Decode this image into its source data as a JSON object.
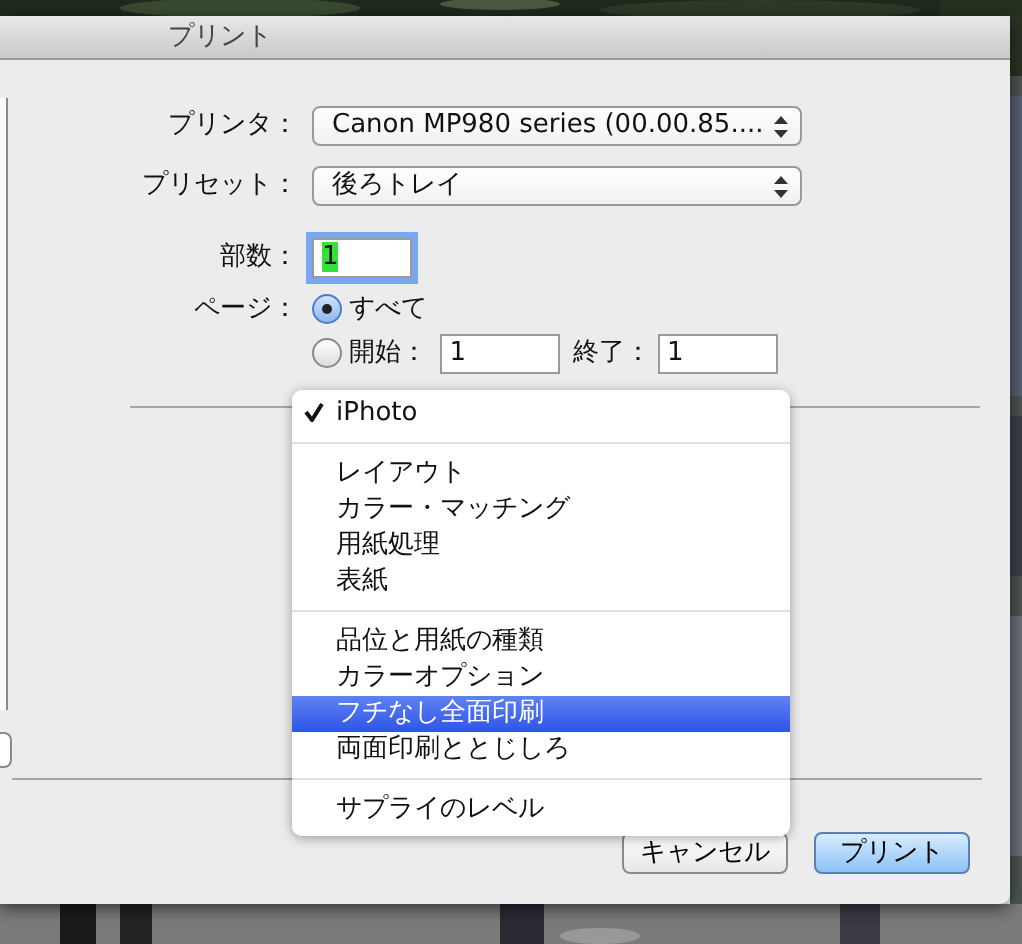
{
  "window": {
    "title": "プリント"
  },
  "printer": {
    "label": "プリンタ：",
    "value": "Canon MP980 series (00.00.85...."
  },
  "preset": {
    "label": "プリセット：",
    "value": "後ろトレイ"
  },
  "copies": {
    "label": "部数：",
    "value": "1",
    "focused": true
  },
  "pages": {
    "label": "ページ：",
    "options": [
      {
        "label": "すべて",
        "selected": true
      },
      {
        "label": "開始：",
        "selected": false
      }
    ],
    "from": "1",
    "to_label": "終了：",
    "to": "1"
  },
  "menu": {
    "items": [
      {
        "kind": "item",
        "label": "iPhoto",
        "checked": true,
        "selected": false
      },
      {
        "kind": "separator"
      },
      {
        "kind": "item",
        "label": "レイアウト",
        "checked": false,
        "selected": false
      },
      {
        "kind": "item",
        "label": "カラー・マッチング",
        "checked": false,
        "selected": false
      },
      {
        "kind": "item",
        "label": "用紙処理",
        "checked": false,
        "selected": false
      },
      {
        "kind": "item",
        "label": "表紙",
        "checked": false,
        "selected": false
      },
      {
        "kind": "separator"
      },
      {
        "kind": "item",
        "label": "品位と用紙の種類",
        "checked": false,
        "selected": false
      },
      {
        "kind": "item",
        "label": "カラーオプション",
        "checked": false,
        "selected": false
      },
      {
        "kind": "item",
        "label": "フチなし全面印刷",
        "checked": false,
        "selected": true
      },
      {
        "kind": "item",
        "label": "両面印刷ととじしろ",
        "checked": false,
        "selected": false
      },
      {
        "kind": "separator"
      },
      {
        "kind": "item",
        "label": "サプライのレベル",
        "checked": false,
        "selected": false
      }
    ]
  },
  "buttons": [
    {
      "label": "キャンセル",
      "default": false
    },
    {
      "label": "プリント",
      "default": true
    }
  ]
}
